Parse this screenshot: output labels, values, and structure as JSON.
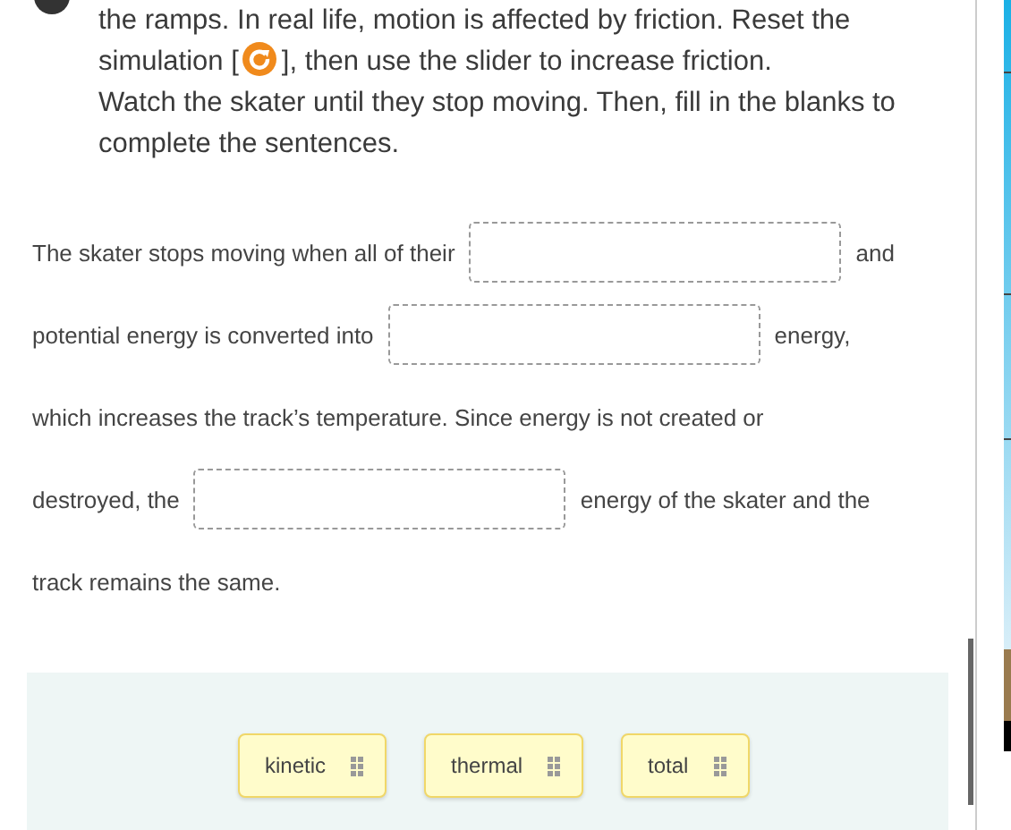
{
  "instructions": {
    "first_line": "the ramps. In real life, motion is affected by friction. Reset the",
    "before_icon": "simulation [",
    "after_icon": "], then use the slider to increase friction.",
    "second": "Watch the skater until they stop moving. Then, fill in the blanks to complete the sentences."
  },
  "sentence_lines": [
    {
      "segments": [
        {
          "kind": "text",
          "text": "The skater stops moving when all of their"
        },
        {
          "kind": "blank"
        },
        {
          "kind": "text",
          "text": "and"
        }
      ]
    },
    {
      "segments": [
        {
          "kind": "text",
          "text": "potential energy is converted into"
        },
        {
          "kind": "blank"
        },
        {
          "kind": "text",
          "text": "energy,"
        }
      ]
    },
    {
      "segments": [
        {
          "kind": "text",
          "text": "which increases the track’s temperature. Since energy is not created or"
        }
      ]
    },
    {
      "segments": [
        {
          "kind": "text",
          "text": "destroyed, the"
        },
        {
          "kind": "blank"
        },
        {
          "kind": "text",
          "text": "energy of the skater and the"
        }
      ]
    },
    {
      "segments": [
        {
          "kind": "text",
          "text": "track remains the same."
        }
      ]
    }
  ],
  "word_bank": [
    {
      "label": "kinetic"
    },
    {
      "label": "thermal"
    },
    {
      "label": "total"
    }
  ]
}
